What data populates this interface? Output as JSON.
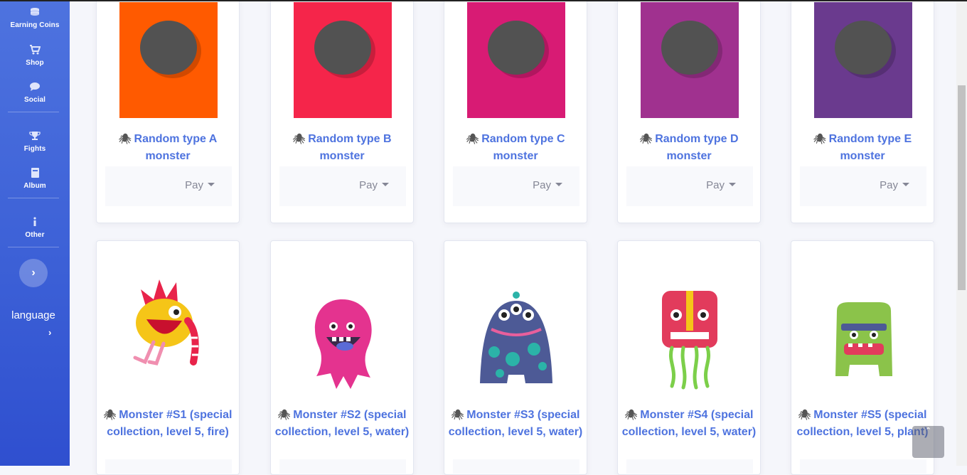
{
  "sidebar": {
    "items": [
      {
        "label": "Earning Coins",
        "icon": "coins-icon"
      },
      {
        "label": "Shop",
        "icon": "cart-icon"
      },
      {
        "label": "Social",
        "icon": "comment-icon"
      },
      {
        "label": "Fights",
        "icon": "trophy-icon"
      },
      {
        "label": "Album",
        "icon": "book-icon"
      },
      {
        "label": "Other",
        "icon": "info-icon"
      }
    ],
    "toggle_icon": "›",
    "language_label": "language",
    "language_arrow": "›",
    "accent": "#4e73df"
  },
  "random_cards": [
    {
      "title": "Random type A monster",
      "pay_label": "Pay",
      "color": "#ff5a00"
    },
    {
      "title": "Random type B monster",
      "pay_label": "Pay",
      "color": "#f5254a"
    },
    {
      "title": "Random type C monster",
      "pay_label": "Pay",
      "color": "#d81b74"
    },
    {
      "title": "Random type D monster",
      "pay_label": "Pay",
      "color": "#a0318f"
    },
    {
      "title": "Random type E monster",
      "pay_label": "Pay",
      "color": "#6a3a8e"
    }
  ],
  "special_cards": [
    {
      "title": "Monster #S1 (special collection, level 5, fire)",
      "monster": "yellow-bird-monster"
    },
    {
      "title": "Monster #S2 (special collection, level 5, water)",
      "monster": "pink-fluffy-monster"
    },
    {
      "title": "Monster #S3 (special collection, level 5, water)",
      "monster": "blue-three-eyed-monster"
    },
    {
      "title": "Monster #S4 (special collection, level 5, water)",
      "monster": "red-tentacle-monster"
    },
    {
      "title": "Monster #S5 (special collection, level 5, plant)",
      "monster": "green-block-monster"
    }
  ],
  "title_icon": "🕷",
  "back_to_top": "ˆ"
}
